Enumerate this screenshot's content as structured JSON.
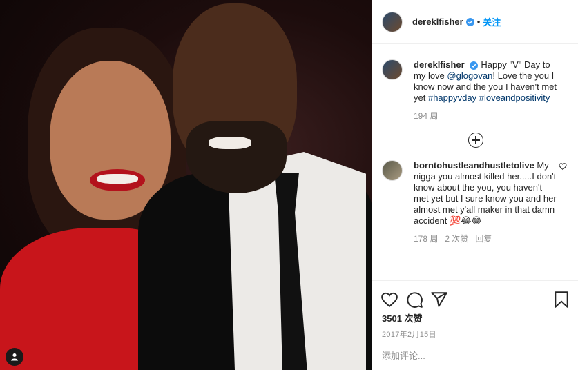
{
  "post": {
    "username": "dereklfisher",
    "follow_label": "关注",
    "separator": "•"
  },
  "caption": {
    "username": "dereklfisher",
    "text_1": "Happy \"V\" Day to my love ",
    "mention": "@glogovan",
    "text_2": "! Love the you I know now and the you I haven't met yet ",
    "hashtag_1": "#happyvday",
    "hashtag_2": "#loveandpositivity",
    "age": "194 周"
  },
  "comments": [
    {
      "username": "borntohustleandhustletolive",
      "text": "My nigga you almost killed her.....I don't know about the you, you haven't met yet but I sure know you and her almost met y'all maker in that damn accident 💯😂😂",
      "age": "178 周",
      "likes": "2 次赞",
      "reply_label": "回复"
    }
  ],
  "actions": {
    "likes": "3501 次赞",
    "date": "2017年2月15日",
    "comment_placeholder": "添加评论..."
  },
  "colors": {
    "accent": "#0095f6",
    "link": "#00376b",
    "meta": "#8e8e8e"
  },
  "icons": [
    "verified-badge-icon",
    "add-comments-icon",
    "heart-icon",
    "comment-icon",
    "share-icon",
    "bookmark-icon",
    "user-tag-icon"
  ]
}
